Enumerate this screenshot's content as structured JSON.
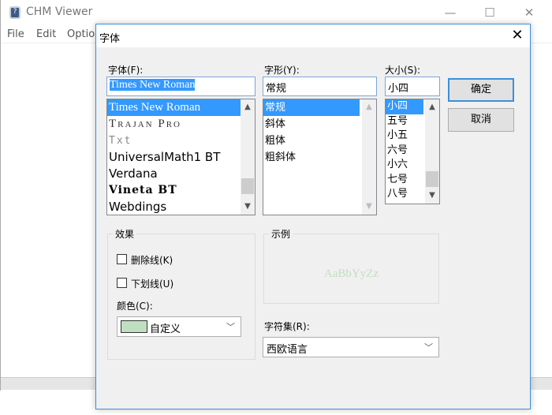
{
  "main_window": {
    "title": "CHM Viewer",
    "menu": [
      "File",
      "Edit",
      "Optio"
    ],
    "controls": {
      "minimize": "—",
      "maximize": "☐",
      "close": "✕"
    }
  },
  "dialog": {
    "title": "字体",
    "close": "✕",
    "font": {
      "label": "字体(F):",
      "value": "Times New Roman",
      "items": [
        "Times New Roman",
        "Trajan Pro",
        "Txt",
        "UniversalMath1 BT",
        "Verdana",
        "Vineta BT",
        "Webdings"
      ],
      "selected": 0
    },
    "style": {
      "label": "字形(Y):",
      "value": "常规",
      "items": [
        "常规",
        "斜体",
        "粗体",
        "粗斜体"
      ],
      "selected": 0
    },
    "size": {
      "label": "大小(S):",
      "value": "小四",
      "items": [
        "小四",
        "五号",
        "小五",
        "六号",
        "小六",
        "七号",
        "八号"
      ],
      "selected": 0
    },
    "ok_label": "确定",
    "cancel_label": "取消",
    "effects": {
      "title": "效果",
      "strikeout": "删除线(K)",
      "underline": "下划线(U)",
      "strikeout_checked": false,
      "underline_checked": false,
      "color_label": "颜色(C):",
      "color_value": "自定义",
      "color_swatch": "#c0dfc0"
    },
    "sample": {
      "title": "示例",
      "text": "AaBbYyZz",
      "color": "#c0dfc0"
    },
    "charset": {
      "label": "字符集(R):",
      "value": "西欧语言"
    }
  }
}
